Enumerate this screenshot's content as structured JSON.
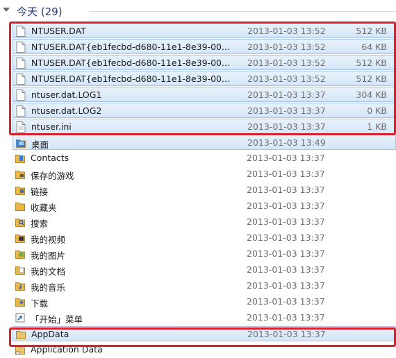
{
  "group": {
    "title": "今天 (29)"
  },
  "rows": [
    {
      "name": "NTUSER.DAT",
      "date": "2013-01-03 13:52",
      "size": "512 KB",
      "icon": "file-icon",
      "selected": true
    },
    {
      "name": "NTUSER.DAT{eb1fecbd-d680-11e1-8e39-00...",
      "date": "2013-01-03 13:52",
      "size": "64 KB",
      "icon": "file-icon",
      "selected": true
    },
    {
      "name": "NTUSER.DAT{eb1fecbd-d680-11e1-8e39-00...",
      "date": "2013-01-03 13:52",
      "size": "512 KB",
      "icon": "file-icon",
      "selected": true
    },
    {
      "name": "NTUSER.DAT{eb1fecbd-d680-11e1-8e39-00...",
      "date": "2013-01-03 13:52",
      "size": "512 KB",
      "icon": "file-icon",
      "selected": true
    },
    {
      "name": "ntuser.dat.LOG1",
      "date": "2013-01-03 13:37",
      "size": "304 KB",
      "icon": "file-icon",
      "selected": true
    },
    {
      "name": "ntuser.dat.LOG2",
      "date": "2013-01-03 13:37",
      "size": "0 KB",
      "icon": "file-icon",
      "selected": true
    },
    {
      "name": "ntuser.ini",
      "date": "2013-01-03 13:37",
      "size": "1 KB",
      "icon": "ini-file-icon",
      "selected": true
    },
    {
      "name": "桌面",
      "date": "2013-01-03 13:49",
      "size": "",
      "icon": "desktop-folder-icon",
      "selected": true
    },
    {
      "name": "Contacts",
      "date": "2013-01-03 13:37",
      "size": "",
      "icon": "contacts-folder-icon",
      "selected": false
    },
    {
      "name": "保存的游戏",
      "date": "2013-01-03 13:37",
      "size": "",
      "icon": "saved-games-folder-icon",
      "selected": false
    },
    {
      "name": "链接",
      "date": "2013-01-03 13:37",
      "size": "",
      "icon": "links-folder-icon",
      "selected": false
    },
    {
      "name": "收藏夹",
      "date": "2013-01-03 13:37",
      "size": "",
      "icon": "favorites-folder-icon",
      "selected": false
    },
    {
      "name": "搜索",
      "date": "2013-01-03 13:37",
      "size": "",
      "icon": "searches-folder-icon",
      "selected": false
    },
    {
      "name": "我的视频",
      "date": "2013-01-03 13:37",
      "size": "",
      "icon": "videos-folder-icon",
      "selected": false
    },
    {
      "name": "我的图片",
      "date": "2013-01-03 13:37",
      "size": "",
      "icon": "pictures-folder-icon",
      "selected": false
    },
    {
      "name": "我的文档",
      "date": "2013-01-03 13:37",
      "size": "",
      "icon": "documents-folder-icon",
      "selected": false
    },
    {
      "name": "我的音乐",
      "date": "2013-01-03 13:37",
      "size": "",
      "icon": "music-folder-icon",
      "selected": false
    },
    {
      "name": "下载",
      "date": "2013-01-03 13:37",
      "size": "",
      "icon": "downloads-folder-icon",
      "selected": false
    },
    {
      "name": "「开始」菜单",
      "date": "2013-01-03 13:37",
      "size": "",
      "icon": "shortcut-icon",
      "selected": false
    },
    {
      "name": "AppData",
      "date": "2013-01-03 13:37",
      "size": "",
      "icon": "folder-icon",
      "selected": true
    },
    {
      "name": "Application Data",
      "date": "",
      "size": "",
      "icon": "shortcut-folder-icon",
      "selected": false
    }
  ],
  "colors": {
    "highlight_box": "#d6202a",
    "selection": "#d4e6f8",
    "group_title": "#1e3287"
  }
}
